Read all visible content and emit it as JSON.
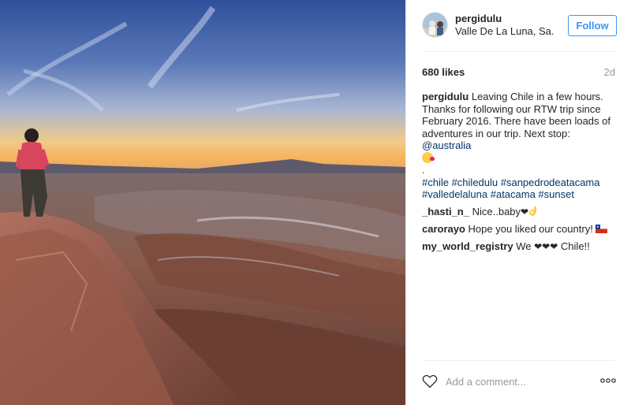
{
  "post": {
    "author": "pergidulu",
    "location": "Valle De La Luna, San Pedro de Atacama",
    "location_display": "Valle De La Luna, Sa...",
    "follow_label": "Follow",
    "likes": "680 likes",
    "time_ago": "2d",
    "caption": {
      "user": "pergidulu",
      "text": "Leaving Chile in a few hours. Thanks for following our RTW trip since February 2016. There have been loads of adventures in our trip. Next stop:",
      "mention": "@australia",
      "dot": ".",
      "hashtags_line1": "#chile #chiledulu #sanpedrodeatacama",
      "hashtags_line2": "#valledelaluna #atacama #sunset"
    },
    "comments": [
      {
        "user": "_hasti_n_",
        "text": "Nice..baby"
      },
      {
        "user": "carorayo",
        "text": "Hope you liked our country!"
      },
      {
        "user": "my_world_registry",
        "text_before": "We",
        "hearts": "❤❤❤",
        "text_after": "Chile!!"
      }
    ],
    "comment_placeholder": "Add a comment...",
    "icons": {
      "like": "heart-outline-icon",
      "more": "more-options-icon",
      "emoji_kiss": "kiss-face-emoji",
      "emoji_ok": "ok-hand-emoji",
      "flag": "chile-flag-emoji"
    },
    "colors": {
      "link": "#003569",
      "follow": "#3897f0",
      "muted": "#999999"
    }
  }
}
